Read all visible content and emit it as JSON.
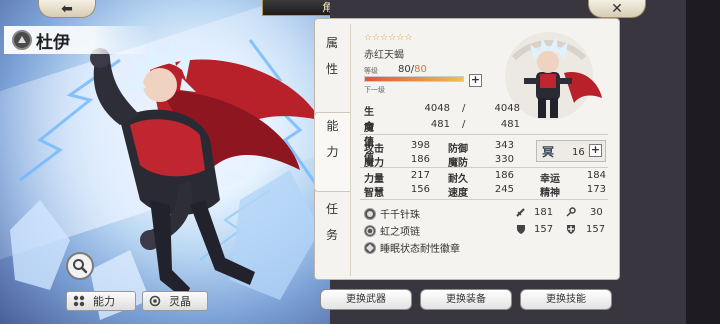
{
  "header": {
    "title": "角色详情",
    "back_glyph": "⬅",
    "close_glyph": "✕"
  },
  "character": {
    "name": "杜伊",
    "title": "赤红天蝎",
    "stars": "☆☆☆☆☆☆",
    "level_label": "等级",
    "level": "80",
    "level_sep": "/",
    "level_max": "80",
    "level_progress": 1.0,
    "next_label": "下一级"
  },
  "tabs": {
    "attribute": [
      "属",
      "性"
    ],
    "ability": [
      "能",
      "力"
    ],
    "task": [
      "任",
      "务"
    ]
  },
  "vitals": [
    {
      "label": "生命值",
      "current": "4048",
      "sep": "/",
      "max": "4048"
    },
    {
      "label": "魔法值",
      "current": "481",
      "sep": "/",
      "max": "481"
    }
  ],
  "stats": [
    {
      "label": "攻击",
      "value": "398"
    },
    {
      "label": "防御",
      "value": "343"
    },
    {
      "label": "魔力",
      "value": "186"
    },
    {
      "label": "魔防",
      "value": "330"
    },
    {
      "label": "力量",
      "value": "217"
    },
    {
      "label": "耐久",
      "value": "186"
    },
    {
      "label": "幸运",
      "value": "184"
    },
    {
      "label": "智慧",
      "value": "156"
    },
    {
      "label": "速度",
      "value": "245"
    },
    {
      "label": "精神",
      "value": "173"
    }
  ],
  "points": {
    "icon_glyph": "冥",
    "value": "16"
  },
  "equipment": [
    {
      "name": "千千针珠"
    },
    {
      "name": "虹之项链"
    },
    {
      "name": "睡眠状态耐性徽章"
    }
  ],
  "equip_stats": {
    "atk": "181",
    "key": "30",
    "def": "157",
    "mdef": "157"
  },
  "buttons": {
    "weapon": "更换武器",
    "equip": "更换装备",
    "skill": "更换技能",
    "ability": "能力",
    "crystal": "灵晶"
  },
  "colors": {
    "accent_gold": "#d8a23a",
    "panel_bg": "#f5f3ef",
    "level_bar": "#e6523a"
  }
}
